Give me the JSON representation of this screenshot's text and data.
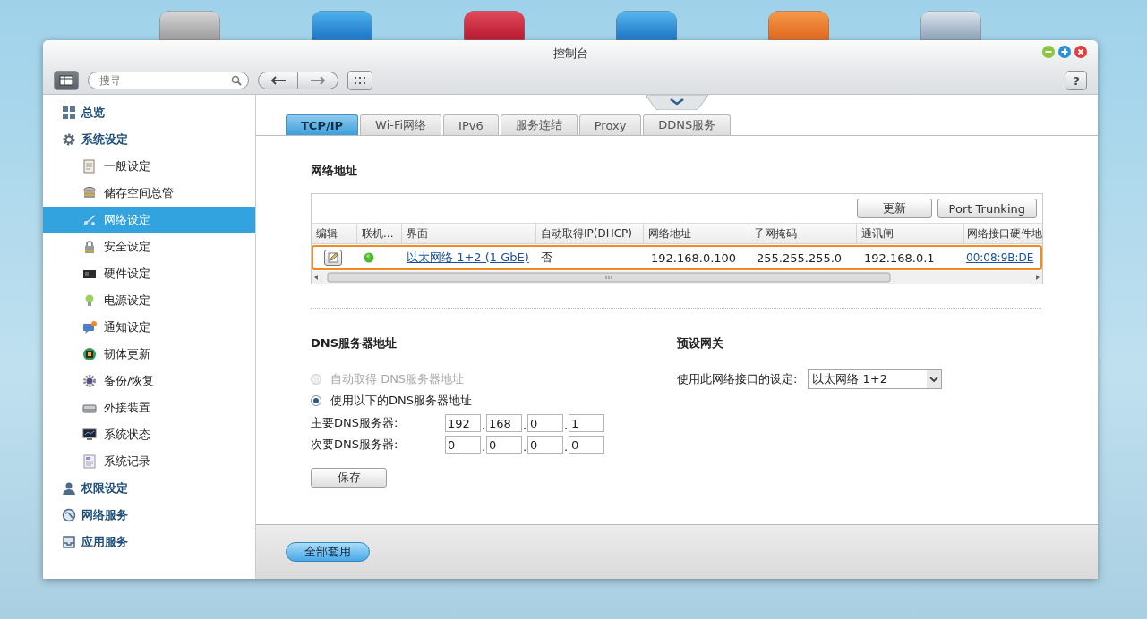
{
  "window": {
    "title": "控制台"
  },
  "toolbar": {
    "search_placeholder": "搜寻",
    "help": "?"
  },
  "sidebar": {
    "items": [
      {
        "label": "总览",
        "selected": false
      },
      {
        "label": "系统设定",
        "selected": false,
        "children": [
          {
            "label": "一般设定",
            "selected": false
          },
          {
            "label": "储存空间总管",
            "selected": false
          },
          {
            "label": "网络设定",
            "selected": true
          },
          {
            "label": "安全设定",
            "selected": false
          },
          {
            "label": "硬件设定",
            "selected": false
          },
          {
            "label": "电源设定",
            "selected": false
          },
          {
            "label": "通知设定",
            "selected": false
          },
          {
            "label": "韧体更新",
            "selected": false
          },
          {
            "label": "备份/恢复",
            "selected": false
          },
          {
            "label": "外接装置",
            "selected": false
          },
          {
            "label": "系统状态",
            "selected": false
          },
          {
            "label": "系统记录",
            "selected": false
          }
        ]
      },
      {
        "label": "权限设定",
        "selected": false
      },
      {
        "label": "网络服务",
        "selected": false
      },
      {
        "label": "应用服务",
        "selected": false
      }
    ]
  },
  "tabs": [
    {
      "label": "TCP/IP",
      "selected": true
    },
    {
      "label": "Wi-Fi网络",
      "selected": false
    },
    {
      "label": "IPv6",
      "selected": false
    },
    {
      "label": "服务连结",
      "selected": false
    },
    {
      "label": "Proxy",
      "selected": false
    },
    {
      "label": "DDNS服务",
      "selected": false
    }
  ],
  "network": {
    "title": "网络地址",
    "buttons": [
      "更新",
      "Port Trunking"
    ],
    "table": {
      "columns": [
        "编辑",
        "联机...",
        "界面",
        "自动取得IP(DHCP)",
        "网络地址",
        "子网掩码",
        "通讯闸",
        "网络接口硬件地"
      ],
      "rows": [
        {
          "selected": true,
          "online": true,
          "interface": "以太网络 1+2 (1 GbE)",
          "dhcp": "否",
          "ip": "192.168.0.100",
          "mask": "255.255.255.0",
          "gateway": "192.168.0.1",
          "mac": "00:08:9B:DE"
        }
      ]
    }
  },
  "dns": {
    "title": "DNS服务器地址",
    "options": [
      {
        "label": "自动取得 DNS服务器地址",
        "selected": false,
        "disabled": true
      },
      {
        "label": "使用以下的DNS服务器地址",
        "selected": true,
        "disabled": false
      }
    ],
    "servers": [
      {
        "label": "主要DNS服务器:",
        "octets": [
          "192",
          "168",
          "0",
          "1"
        ],
        "separators": [
          ".",
          ".",
          "."
        ]
      },
      {
        "label": "次要DNS服务器:",
        "octets": [
          "0",
          "0",
          "0",
          "0"
        ],
        "separators": [
          ".",
          ".",
          "."
        ]
      }
    ],
    "save": "保存"
  },
  "gateway": {
    "title": "预设网关",
    "label": "使用此网络接口的设定:",
    "value": "以太网络 1+2"
  },
  "footer": {
    "apply": "全部套用"
  }
}
